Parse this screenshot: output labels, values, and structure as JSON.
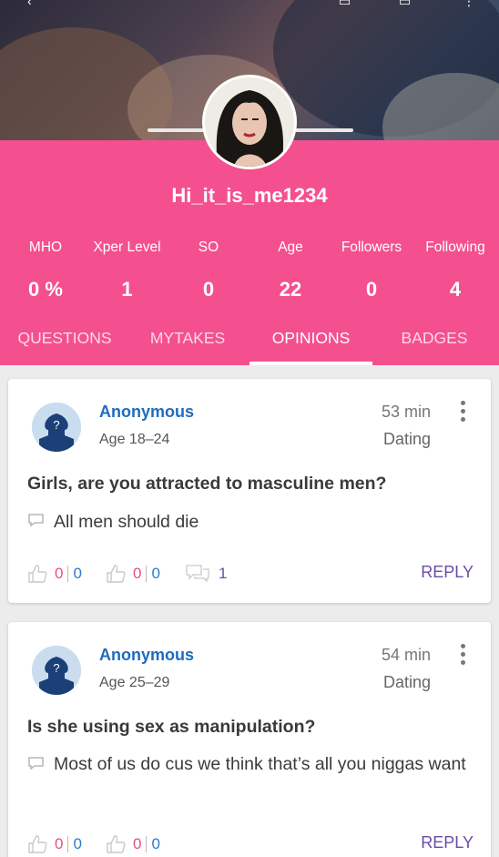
{
  "profile": {
    "username": "Hi_it_is_me1234",
    "stats": [
      {
        "label": "MHO",
        "value": "0 %"
      },
      {
        "label": "Xper Level",
        "value": "1"
      },
      {
        "label": "SO",
        "value": "0"
      },
      {
        "label": "Age",
        "value": "22"
      },
      {
        "label": "Followers",
        "value": "0"
      },
      {
        "label": "Following",
        "value": "4"
      }
    ],
    "tabs": [
      "QUESTIONS",
      "MYTAKES",
      "OPINIONS",
      "BADGES"
    ],
    "active_tab": "OPINIONS"
  },
  "colors": {
    "pink": "#f4508f",
    "author_blue": "#1e6bbf",
    "reply_purple": "#6a4ca8",
    "like_pink": "#e94c8a"
  },
  "opinions": [
    {
      "author": "Anonymous",
      "age": "Age 18–24",
      "time": "53 min",
      "topic": "Dating",
      "question": "Girls, are you attracted to masculine men?",
      "opinion": "All men should die",
      "likes_a": "0",
      "likes_b": "0",
      "dislikes_a": "0",
      "dislikes_b": "0",
      "replies": "1",
      "reply_label": "REPLY"
    },
    {
      "author": "Anonymous",
      "age": "Age 25–29",
      "time": "54 min",
      "topic": "Dating",
      "question": "Is she using sex as manipulation?",
      "opinion": "Most of us do cus we think that’s all you niggas want",
      "likes_a": "0",
      "likes_b": "0",
      "dislikes_a": "0",
      "dislikes_b": "0",
      "reply_label": "REPLY"
    }
  ]
}
